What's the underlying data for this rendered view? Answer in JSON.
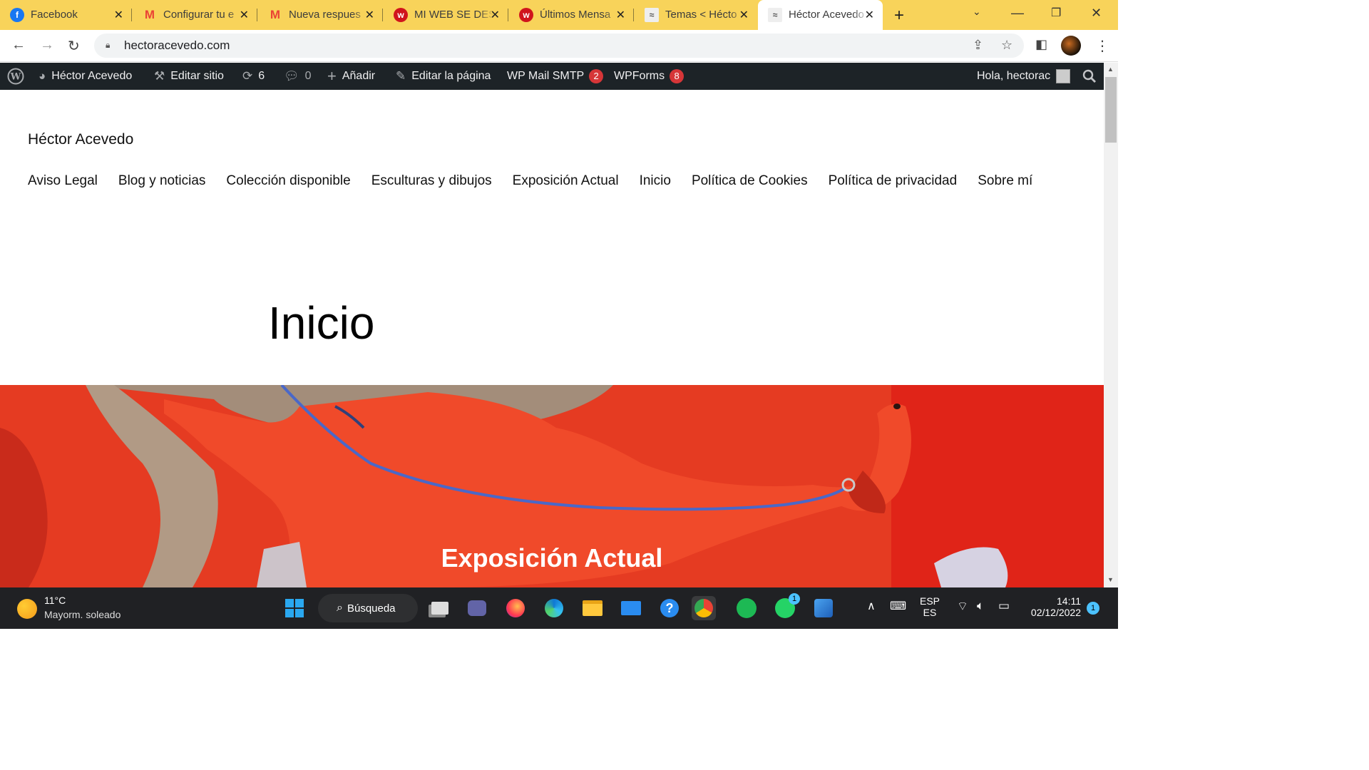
{
  "browser": {
    "tabs": [
      {
        "title": "Facebook",
        "icon": "facebook-icon",
        "color": "#1877f2",
        "glyph": "f"
      },
      {
        "title": "Configurar tu e",
        "icon": "gmail-icon",
        "color": "#ea4335",
        "glyph": "M"
      },
      {
        "title": "Nueva respues",
        "icon": "gmail-icon",
        "color": "#ea4335",
        "glyph": "M"
      },
      {
        "title": "MI WEB SE DES",
        "icon": "webnode-icon",
        "color": "#d0141c",
        "glyph": "w"
      },
      {
        "title": "Últimos Mensa",
        "icon": "webnode-icon",
        "color": "#d0141c",
        "glyph": "w"
      },
      {
        "title": "Temas < Hécto",
        "icon": "site-icon",
        "color": "#888888",
        "glyph": "≈"
      },
      {
        "title": "Héctor Acevedo",
        "icon": "site-icon",
        "color": "#888888",
        "glyph": "≈"
      }
    ],
    "url": "hectoracevedo.com"
  },
  "wp_admin_bar": {
    "site_name": "Héctor Acevedo",
    "edit_site": "Editar sitio",
    "updates_count": "6",
    "comments_count": "0",
    "add_new": "Añadir",
    "edit_page": "Editar la página",
    "wp_mail_smtp": "WP Mail SMTP",
    "wp_mail_smtp_badge": "2",
    "wpforms": "WPForms",
    "wpforms_badge": "8",
    "greeting": "Hola, hectorac"
  },
  "site": {
    "title": "Héctor Acevedo",
    "nav": [
      "Aviso Legal",
      "Blog y noticias",
      "Colección disponible",
      "Esculturas y dibujos",
      "Exposición Actual",
      "Inicio",
      "Política de Cookies",
      "Política de privacidad",
      "Sobre mí"
    ],
    "page_heading": "Inicio",
    "hero_title": "Exposición Actual"
  },
  "taskbar": {
    "weather_temp": "11°C",
    "weather_desc": "Mayorm. soleado",
    "search_label": "Búsqueda",
    "lang_top": "ESP",
    "lang_bottom": "ES",
    "time": "14:11",
    "date": "02/12/2022",
    "notification_count": "1",
    "whatsapp_badge": "1"
  }
}
